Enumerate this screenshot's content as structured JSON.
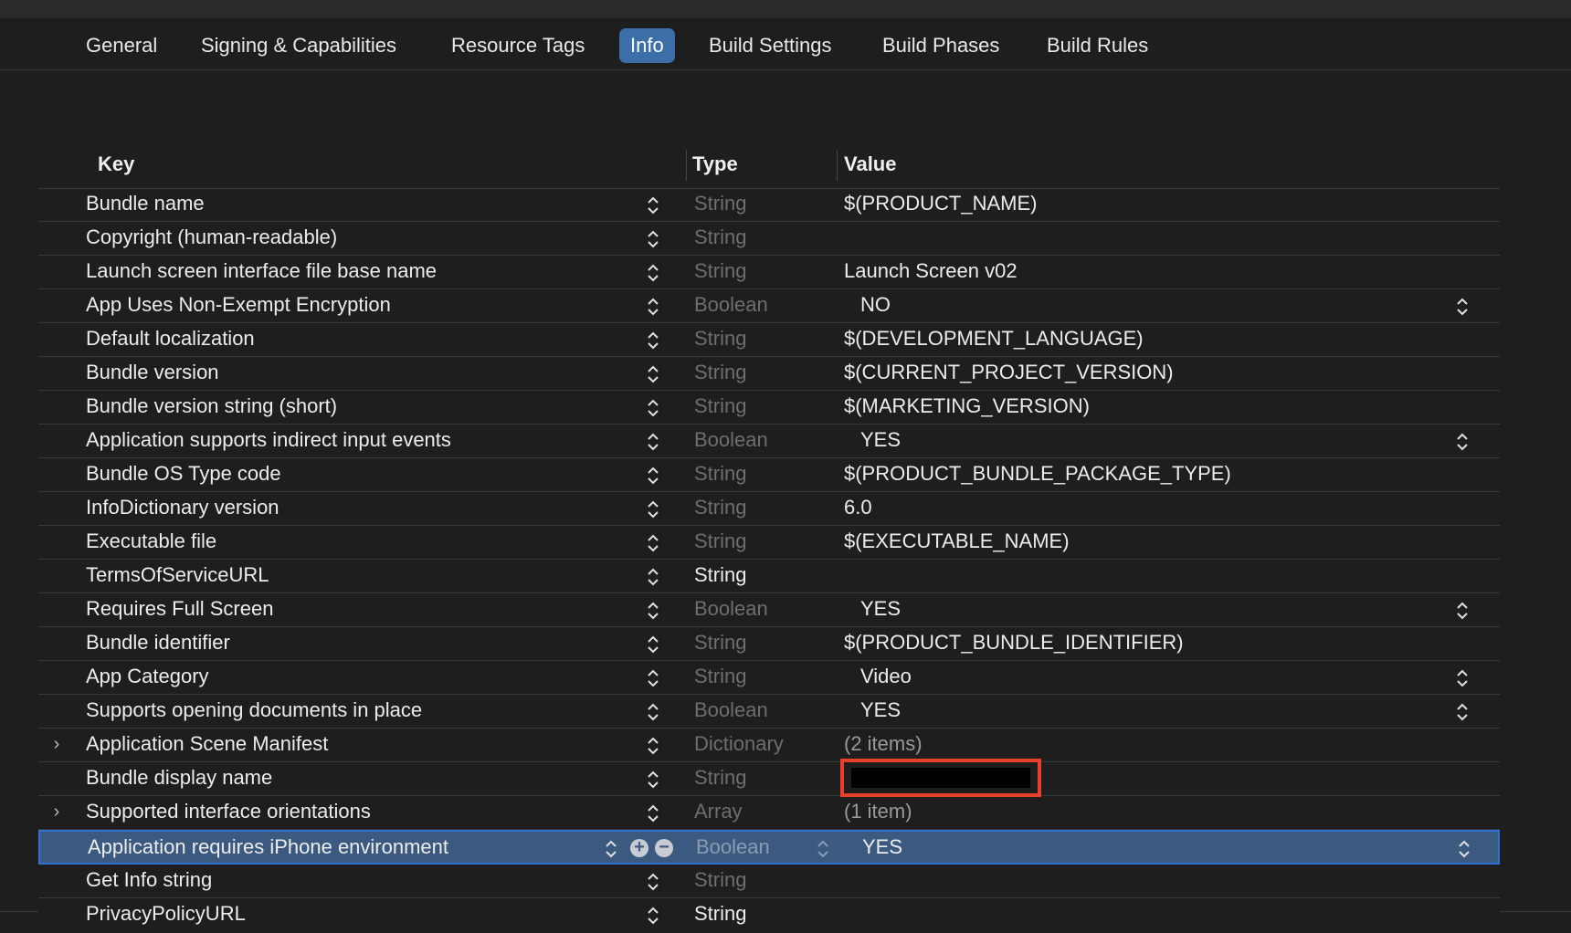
{
  "tabs": [
    {
      "label": "General"
    },
    {
      "label": "Signing & Capabilities"
    },
    {
      "label": "Resource Tags"
    },
    {
      "label": "Info"
    },
    {
      "label": "Build Settings"
    },
    {
      "label": "Build Phases"
    },
    {
      "label": "Build Rules"
    }
  ],
  "active_tab": "Info",
  "columns": {
    "key": "Key",
    "type": "Type",
    "value": "Value"
  },
  "rows": [
    {
      "key": "Bundle name",
      "type": "String",
      "value": "$(PRODUCT_NAME)"
    },
    {
      "key": "Copyright (human-readable)",
      "type": "String",
      "value": ""
    },
    {
      "key": "Launch screen interface file base name",
      "type": "String",
      "value": "Launch Screen v02"
    },
    {
      "key": "App Uses Non-Exempt Encryption",
      "type": "Boolean",
      "value": "NO"
    },
    {
      "key": "Default localization",
      "type": "String",
      "value": "$(DEVELOPMENT_LANGUAGE)"
    },
    {
      "key": "Bundle version",
      "type": "String",
      "value": "$(CURRENT_PROJECT_VERSION)"
    },
    {
      "key": "Bundle version string (short)",
      "type": "String",
      "value": "$(MARKETING_VERSION)"
    },
    {
      "key": "Application supports indirect input events",
      "type": "Boolean",
      "value": "YES"
    },
    {
      "key": "Bundle OS Type code",
      "type": "String",
      "value": "$(PRODUCT_BUNDLE_PACKAGE_TYPE)"
    },
    {
      "key": "InfoDictionary version",
      "type": "String",
      "value": "6.0"
    },
    {
      "key": "Executable file",
      "type": "String",
      "value": "$(EXECUTABLE_NAME)"
    },
    {
      "key": "TermsOfServiceURL",
      "type": "String",
      "value": ""
    },
    {
      "key": "Requires Full Screen",
      "type": "Boolean",
      "value": "YES"
    },
    {
      "key": "Bundle identifier",
      "type": "String",
      "value": "$(PRODUCT_BUNDLE_IDENTIFIER)"
    },
    {
      "key": "App Category",
      "type": "String",
      "value": "Video"
    },
    {
      "key": "Supports opening documents in place",
      "type": "Boolean",
      "value": "YES"
    },
    {
      "key": "Application Scene Manifest",
      "type": "Dictionary",
      "value": "(2 items)"
    },
    {
      "key": "Bundle display name",
      "type": "String",
      "value": ""
    },
    {
      "key": "Supported interface orientations",
      "type": "Array",
      "value": "(1 item)"
    },
    {
      "key": "Application requires iPhone environment",
      "type": "Boolean",
      "value": "YES"
    },
    {
      "key": "Get Info string",
      "type": "String",
      "value": ""
    },
    {
      "key": "PrivacyPolicyURL",
      "type": "String",
      "value": ""
    }
  ],
  "colors": {
    "accent": "#3c6ea8",
    "selection": "#3c5a80",
    "redaction_border": "#e8402a"
  },
  "icons": {
    "stepper": "up-down-chevron-icon",
    "disclosure": "chevron-right-icon",
    "add": "plus-circle-icon",
    "remove": "minus-circle-icon"
  }
}
